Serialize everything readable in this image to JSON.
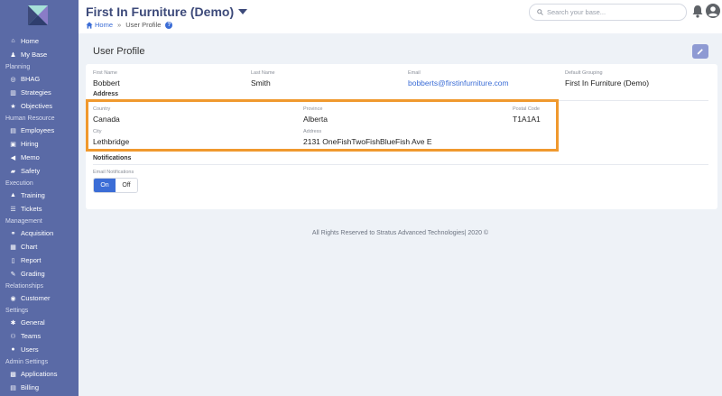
{
  "sidebar": {
    "sections": [
      {
        "label": "",
        "items": [
          {
            "label": "Home",
            "icon": "home-icon"
          },
          {
            "label": "My Base",
            "icon": "person-icon"
          }
        ]
      },
      {
        "label": "Planning",
        "items": [
          {
            "label": "BHAG",
            "icon": "target-icon"
          },
          {
            "label": "Strategies",
            "icon": "chart-bars-icon"
          },
          {
            "label": "Objectives",
            "icon": "star-icon"
          }
        ]
      },
      {
        "label": "Human Resource",
        "items": [
          {
            "label": "Employees",
            "icon": "id-card-icon"
          },
          {
            "label": "Hiring",
            "icon": "briefcase-icon"
          },
          {
            "label": "Memo",
            "icon": "megaphone-icon"
          },
          {
            "label": "Safety",
            "icon": "car-icon"
          }
        ]
      },
      {
        "label": "Execution",
        "items": [
          {
            "label": "Training",
            "icon": "graduation-cap-icon"
          },
          {
            "label": "Tickets",
            "icon": "list-icon"
          }
        ]
      },
      {
        "label": "Management",
        "items": [
          {
            "label": "Acquisition",
            "icon": "handshake-icon"
          },
          {
            "label": "Chart",
            "icon": "org-chart-icon"
          },
          {
            "label": "Report",
            "icon": "file-icon"
          },
          {
            "label": "Grading",
            "icon": "pencil-icon"
          }
        ]
      },
      {
        "label": "Relationships",
        "items": [
          {
            "label": "Customer",
            "icon": "comment-icon"
          }
        ]
      },
      {
        "label": "Settings",
        "items": [
          {
            "label": "General",
            "icon": "gear-icon"
          },
          {
            "label": "Teams",
            "icon": "users-icon"
          },
          {
            "label": "Users",
            "icon": "user-icon"
          }
        ]
      },
      {
        "label": "Admin Settings",
        "items": [
          {
            "label": "Applications",
            "icon": "app-icon"
          },
          {
            "label": "Billing",
            "icon": "invoice-icon"
          }
        ]
      }
    ]
  },
  "header": {
    "title": "First In Furniture (Demo)",
    "breadcrumb": {
      "home": "Home",
      "separator": "»",
      "current": "User Profile",
      "help": "?"
    },
    "search_placeholder": "Search your base..."
  },
  "page": {
    "title": "User Profile"
  },
  "profile": {
    "first_name_label": "First Name",
    "first_name": "Bobbert",
    "last_name_label": "Last Name",
    "last_name": "Smith",
    "email_label": "Email",
    "email": "bobberts@firstinfurniture.com",
    "grouping_label": "Default Grouping",
    "grouping": "First In Furniture (Demo)"
  },
  "address": {
    "section_title": "Address",
    "country_label": "Country",
    "country": "Canada",
    "province_label": "Province",
    "province": "Alberta",
    "postal_label": "Postal Code",
    "postal": "T1A1A1",
    "city_label": "City",
    "city": "Lethbridge",
    "address_label": "Address",
    "address": "2131 OneFishTwoFishBlueFish Ave E"
  },
  "notifications": {
    "section_title": "Notifications",
    "email_label": "Email Notifications",
    "on_label": "On",
    "off_label": "Off",
    "selected": "On"
  },
  "footer": {
    "text": "All Rights Reserved to Stratus Advanced Technologies| 2020 ©"
  },
  "colors": {
    "sidebar": "#5a6aa6",
    "accent": "#3b6dd6",
    "highlight": "#f0992e",
    "title": "#3d4a7a"
  }
}
